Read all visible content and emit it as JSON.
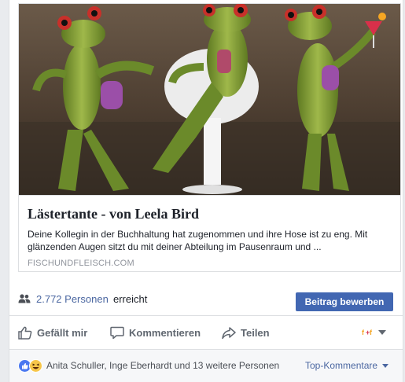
{
  "link_preview": {
    "image_alt_icon": "frogs-photo",
    "title": "Lästertante - von Leela Bird",
    "description": "Deine Kollegin in der Buchhaltung hat zugenommen und ihre Hose ist zu eng. Mit glänzenden Augen sitzt du mit deiner Abteilung im Pausenraum und ...",
    "domain": "FISCHUNDFLEISCH.COM"
  },
  "reach": {
    "icon": "people-icon",
    "count_label": "2.772 Personen",
    "suffix": "erreicht",
    "promote_button": "Beitrag bewerben"
  },
  "actions": {
    "like_label": "Gefällt mir",
    "comment_label": "Kommentieren",
    "share_label": "Teilen",
    "audience_icon": "page-avatar-icon"
  },
  "reactions": {
    "icons": [
      "like-reaction-icon",
      "haha-reaction-icon"
    ],
    "summary": "Anita Schuller, Inge Eberhardt und 13 weitere Personen",
    "sort_label": "Top-Kommentare"
  },
  "colors": {
    "brand_blue": "#4267b2",
    "link_blue": "#4b67a1",
    "muted_gray": "#606770"
  }
}
